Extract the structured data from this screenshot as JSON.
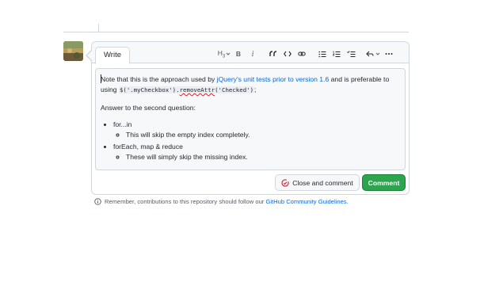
{
  "tabs": {
    "write": "Write"
  },
  "toolbar": {
    "heading": "H",
    "heading_sub": "3",
    "bold": "B",
    "italic": "i",
    "quote": "“",
    "code": "<>"
  },
  "editor": {
    "p1_before": "Note that this is the approach used by ",
    "p1_link": "jQuery's unit tests prior to version 1.6",
    "p1_after": " and is preferable to",
    "p1_line2_start": "using ",
    "code_part1": "$('.myCheckbox').",
    "code_part2": "removeAttr",
    "code_part3": "('Checked')",
    "p1_end": ";",
    "p2": "Answer to the second question:",
    "items": [
      {
        "label": "for...in",
        "sub": "This will skip the empty index completely."
      },
      {
        "label": "forEach, map & reduce",
        "sub": "These will simply skip the missing index."
      }
    ]
  },
  "buttons": {
    "close": "Close and comment",
    "comment": "Comment"
  },
  "notice": {
    "text": "Remember, contributions to this repository should follow our ",
    "link": "GitHub Community Guidelines",
    "end": "."
  },
  "colors": {
    "accent": "#0969da",
    "primary_button": "#2da44e",
    "close_icon": "#cf222e"
  }
}
